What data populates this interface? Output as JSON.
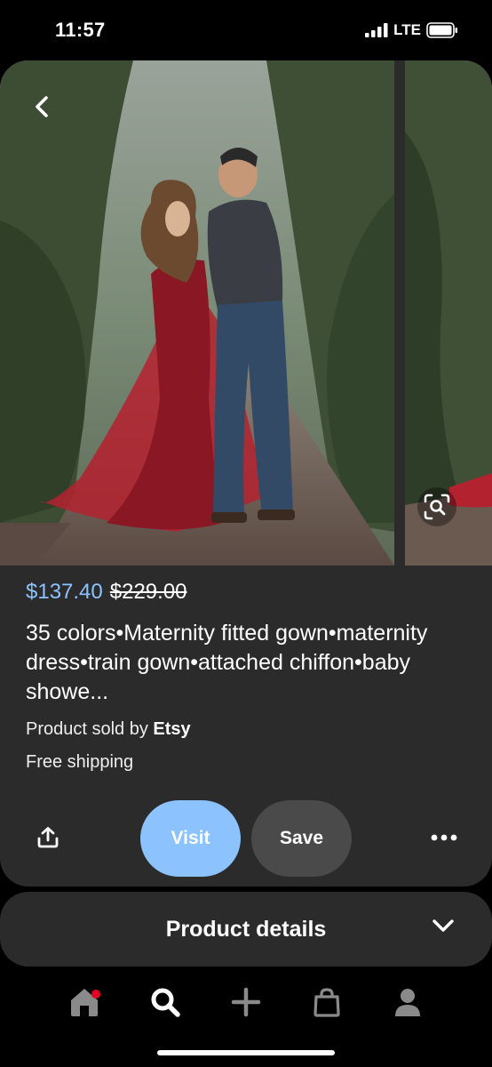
{
  "status": {
    "time": "11:57",
    "network": "LTE"
  },
  "product": {
    "price_current": "$137.40",
    "price_original": "$229.00",
    "title": "35 colors•Maternity fitted gown•maternity dress•train gown•attached chiffon•baby showe...",
    "seller_prefix": "Product sold by",
    "seller_name": "Etsy",
    "shipping": "Free shipping"
  },
  "actions": {
    "visit_label": "Visit",
    "save_label": "Save"
  },
  "details": {
    "label": "Product details"
  },
  "colors": {
    "accent": "#8cc3ff",
    "card": "#2b2b2b",
    "save_bg": "#4a4a4a",
    "notif": "#e60023"
  },
  "icons": [
    "back-arrow-icon",
    "visual-search-icon",
    "share-icon",
    "more-icon",
    "chevron-down-icon",
    "home-icon",
    "search-icon",
    "plus-icon",
    "shopping-bag-icon",
    "profile-icon"
  ]
}
